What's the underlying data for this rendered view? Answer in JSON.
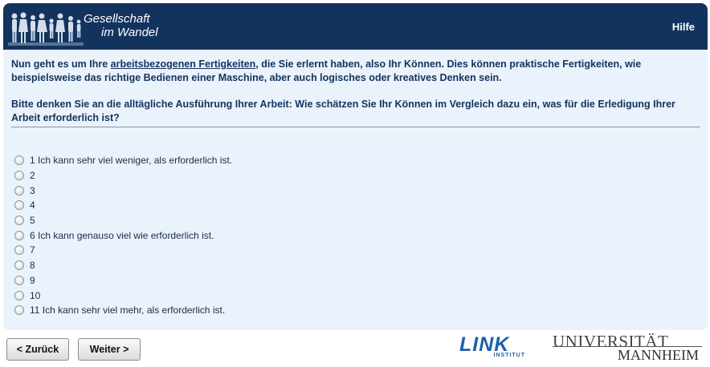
{
  "header": {
    "logo_line1": "Gesellschaft",
    "logo_line2": "im Wandel",
    "help_label": "Hilfe",
    "bg_color": "#13335f"
  },
  "intro": {
    "before": "Nun geht es um Ihre ",
    "underlined": "arbeitsbezogenen Fertigkeiten",
    "after": ", die Sie erlernt haben, also Ihr Können. Dies können praktische Fertigkeiten, wie beispielsweise das richtige Bedienen einer Maschine, aber auch logisches oder kreatives Denken sein."
  },
  "question": "Bitte denken Sie an die alltägliche Ausführung Ihrer Arbeit: Wie schätzen Sie Ihr Können im Vergleich dazu ein, was für die Erledigung Ihrer Arbeit erforderlich ist?",
  "options": [
    "1 Ich kann sehr viel weniger, als erforderlich ist.",
    "2",
    "3",
    "4",
    "5",
    "6 Ich kann genauso viel wie erforderlich ist.",
    "7",
    "8",
    "9",
    "10",
    "11 Ich kann sehr viel mehr, als erforderlich ist."
  ],
  "nav": {
    "back_label": "< Zurück",
    "next_label": "Weiter >"
  },
  "logos": {
    "link_word": "LINK",
    "link_sub": "INSTITUT",
    "uni_line1": "UNIVERSITÄT",
    "uni_line2": "MANNHEIM"
  }
}
